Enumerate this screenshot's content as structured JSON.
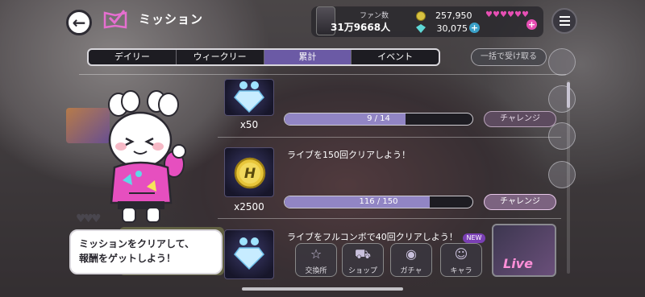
{
  "header": {
    "title": "ミッション",
    "fans_label": "ファン数",
    "fans_value": "31万9668人",
    "coins": "257,950",
    "gems": "30,075",
    "gem_plus": "+",
    "heart_plus": "+",
    "hearts": [
      "♥",
      "♥",
      "♥",
      "♥",
      "♥",
      "♥"
    ]
  },
  "tabs": [
    {
      "label": "デイリー",
      "active": false
    },
    {
      "label": "ウィークリー",
      "active": false
    },
    {
      "label": "累計",
      "active": true
    },
    {
      "label": "イベント",
      "active": false
    }
  ],
  "bulk_claim_label": "一括で受け取る",
  "missions": [
    {
      "reward_icon": "diamond-icon",
      "quantity": "x50",
      "text": "",
      "progress_text": "9 / 14",
      "progress": 0.643,
      "button": "チャレンジ"
    },
    {
      "reward_icon": "coin-icon",
      "quantity": "x2500",
      "text": "ライブを150回クリアしよう！",
      "progress_text": "116 / 150",
      "progress": 0.773,
      "button": "チャレンジ"
    },
    {
      "reward_icon": "diamond-icon",
      "quantity": "",
      "text": "ライブをフルコンボで40回クリアしよう！",
      "progress_text": "",
      "progress": 0,
      "button": ""
    }
  ],
  "new_badge": "NEW",
  "dock": [
    {
      "label": "交換所",
      "icon": "exchange-icon"
    },
    {
      "label": "ショップ",
      "icon": "shop-icon"
    },
    {
      "label": "ガチャ",
      "icon": "gacha-icon"
    },
    {
      "label": "キャラ",
      "icon": "character-icon"
    }
  ],
  "live_label": "Live",
  "tip": {
    "line1": "ミッションをクリアして、",
    "line2": "報酬をゲットしよう！"
  },
  "colors": {
    "accent": "#6b5aa5",
    "progress_fill": "#9185c4",
    "pink": "#e74fb4"
  }
}
